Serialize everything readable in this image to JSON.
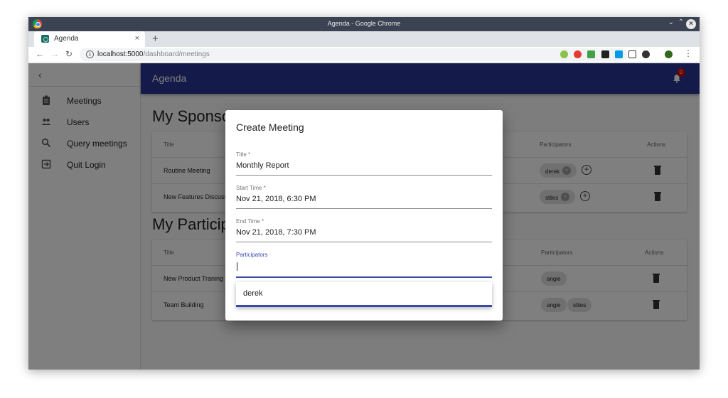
{
  "browser": {
    "window_title": "Agenda - Google Chrome",
    "tab_title": "Agenda",
    "new_tab": "+",
    "tab_close": "×",
    "url_host": "localhost:5000",
    "url_path": "/dashboard/meetings"
  },
  "app": {
    "title": "Agenda",
    "notifications": "0"
  },
  "sidebar": {
    "collapse": "‹",
    "items": [
      {
        "label": "Meetings",
        "icon": "clipboard-icon"
      },
      {
        "label": "Users",
        "icon": "people-icon"
      },
      {
        "label": "Query meetings",
        "icon": "search-icon"
      },
      {
        "label": "Quit Login",
        "icon": "exit-icon"
      }
    ]
  },
  "sponsored": {
    "heading": "My Sponsored Meetings",
    "headers": {
      "title": "Title",
      "participators": "Participators",
      "actions": "Actions"
    },
    "rows": [
      {
        "title": "Routine Meeting",
        "participant": "derek"
      },
      {
        "title": "New Features Discussion",
        "participant": "stiles"
      }
    ]
  },
  "participated": {
    "heading": "My Participated Meetings",
    "headers": {
      "title": "Title",
      "participators": "Participators",
      "actions": "Actions"
    },
    "rows": [
      {
        "title": "New Product Traning",
        "participants": [
          "angie"
        ]
      },
      {
        "title": "Team Building",
        "participants": [
          "angie",
          "stiles"
        ]
      }
    ]
  },
  "dialog": {
    "title": "Create Meeting",
    "fields": {
      "title": {
        "label": "Title *",
        "value": "Monthly Report"
      },
      "start": {
        "label": "Start Time *",
        "value": "Nov 21, 2018, 6:30 PM"
      },
      "end": {
        "label": "End Time *",
        "value": "Nov 21, 2018, 7:30 PM"
      },
      "participators": {
        "label": "Participators",
        "value": ""
      }
    },
    "suggestions": [
      "derek"
    ]
  },
  "colors": {
    "appbar": "#283593",
    "accent": "#3949ab",
    "badge": "#d50000"
  }
}
